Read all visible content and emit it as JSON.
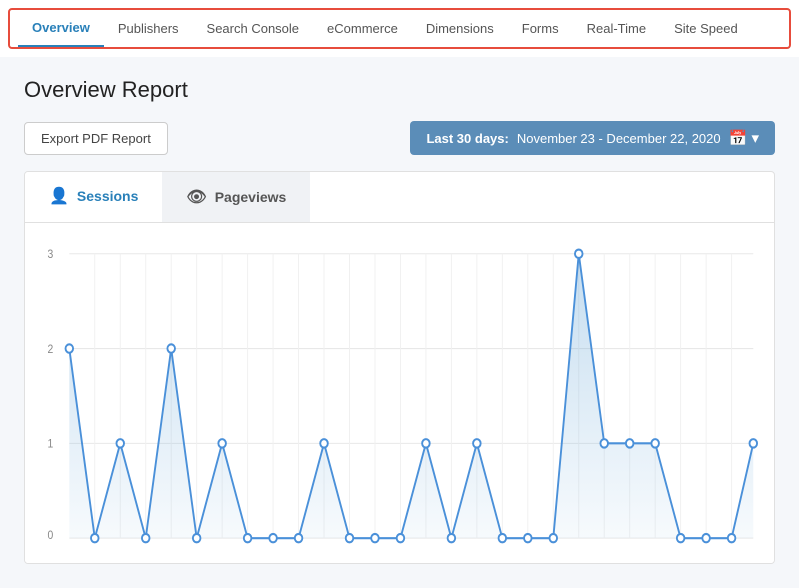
{
  "nav": {
    "items": [
      {
        "id": "overview",
        "label": "Overview",
        "active": true
      },
      {
        "id": "publishers",
        "label": "Publishers",
        "active": false
      },
      {
        "id": "search-console",
        "label": "Search Console",
        "active": false
      },
      {
        "id": "ecommerce",
        "label": "eCommerce",
        "active": false
      },
      {
        "id": "dimensions",
        "label": "Dimensions",
        "active": false
      },
      {
        "id": "forms",
        "label": "Forms",
        "active": false
      },
      {
        "id": "real-time",
        "label": "Real-Time",
        "active": false
      },
      {
        "id": "site-speed",
        "label": "Site Speed",
        "active": false
      }
    ]
  },
  "page": {
    "title": "Overview Report"
  },
  "toolbar": {
    "export_btn": "Export PDF Report",
    "date_label": "Last 30 days:",
    "date_range": "November 23 - December 22, 2020"
  },
  "chart": {
    "tab_sessions": "Sessions",
    "tab_pageviews": "Pageviews",
    "sessions_icon": "👤",
    "pageviews_icon": "👁"
  }
}
